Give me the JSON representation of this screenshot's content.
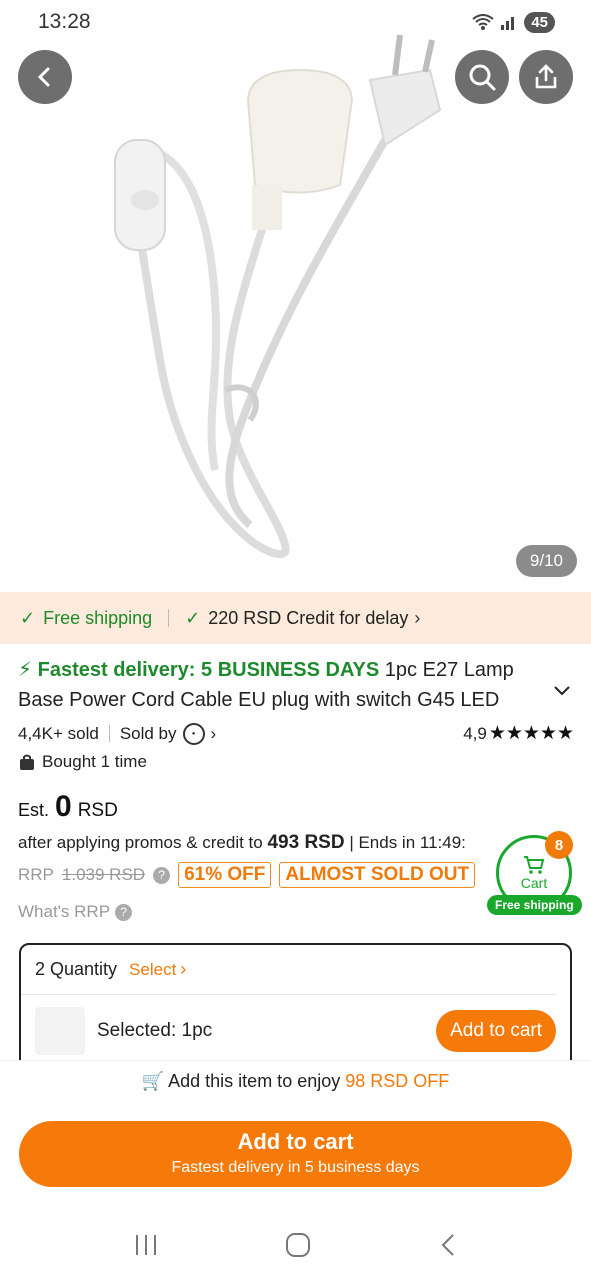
{
  "status": {
    "time": "13:28",
    "battery": "45"
  },
  "hero": {
    "counter": "9/10"
  },
  "shipping": {
    "free": "Free shipping",
    "credit": "220 RSD Credit for delay"
  },
  "title": {
    "fast": "Fastest delivery: 5 BUSINESS DAYS",
    "text": "1pc E27 Lamp Base Power Cord Cable EU plug with switch G45 LED"
  },
  "meta": {
    "sold": "4,4K+ sold",
    "sold_by": "Sold by",
    "rating": "4,9",
    "stars": "★★★★★"
  },
  "bought": "Bought 1 time",
  "price": {
    "est_label": "Est.",
    "est_value": "0",
    "currency": "RSD",
    "after_prefix": "after applying promos & credit to",
    "after_value": "493 RSD",
    "ends": "| Ends in 11:49:",
    "rrp_label": "RRP",
    "rrp_value": "1.039 RSD",
    "discount": "61% OFF",
    "almost": "ALMOST SOLD OUT",
    "what_rrp": "What's RRP"
  },
  "float_cart": {
    "count": "8",
    "label": "Cart",
    "free": "Free shipping"
  },
  "quantity": {
    "title": "2 Quantity",
    "select": "Select",
    "selected": "Selected: 1pc",
    "add_btn": "Add to cart"
  },
  "bottom": {
    "enjoy_prefix": "Add this item to enjoy",
    "enjoy_value": "98 RSD OFF",
    "cart_btn": "Add to cart",
    "cart_sub": "Fastest delivery in 5 business days"
  },
  "colors": {
    "accent": "#f57a0a",
    "green": "#1f8a2d",
    "strip": "#fcebdd"
  }
}
